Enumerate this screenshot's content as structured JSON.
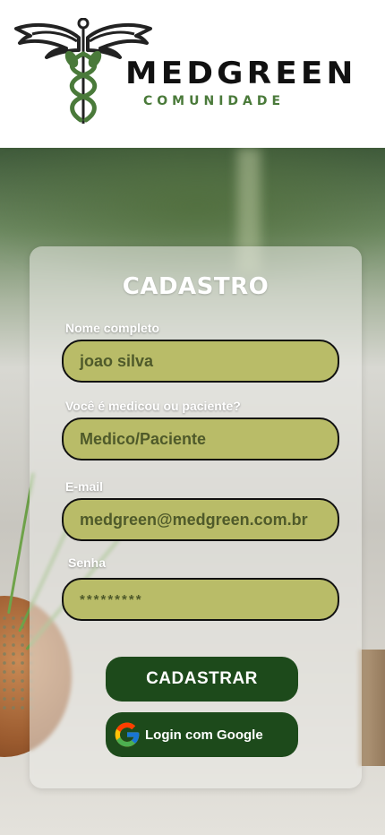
{
  "brand": {
    "name": "MEDGREEN",
    "subtitle": "COMUNIDADE"
  },
  "form": {
    "title": "CADASTRO",
    "fields": [
      {
        "label": "Nome completo",
        "value": "joao silva"
      },
      {
        "label": "Você é medicou ou paciente?",
        "value": "Medico/Paciente"
      },
      {
        "label": "E-mail",
        "value": "medgreen@medgreen.com.br"
      },
      {
        "label": "Senha",
        "value": "*********"
      }
    ],
    "submit_label": "CADASTRAR",
    "google_label": "Login com Google"
  },
  "colors": {
    "field_bg": "#b9bc68",
    "button_bg": "#1d4a1b",
    "brand_green": "#4a7a3a"
  },
  "icons": {
    "logo": "caduceus-wings-icon",
    "google": "google-g-icon"
  }
}
